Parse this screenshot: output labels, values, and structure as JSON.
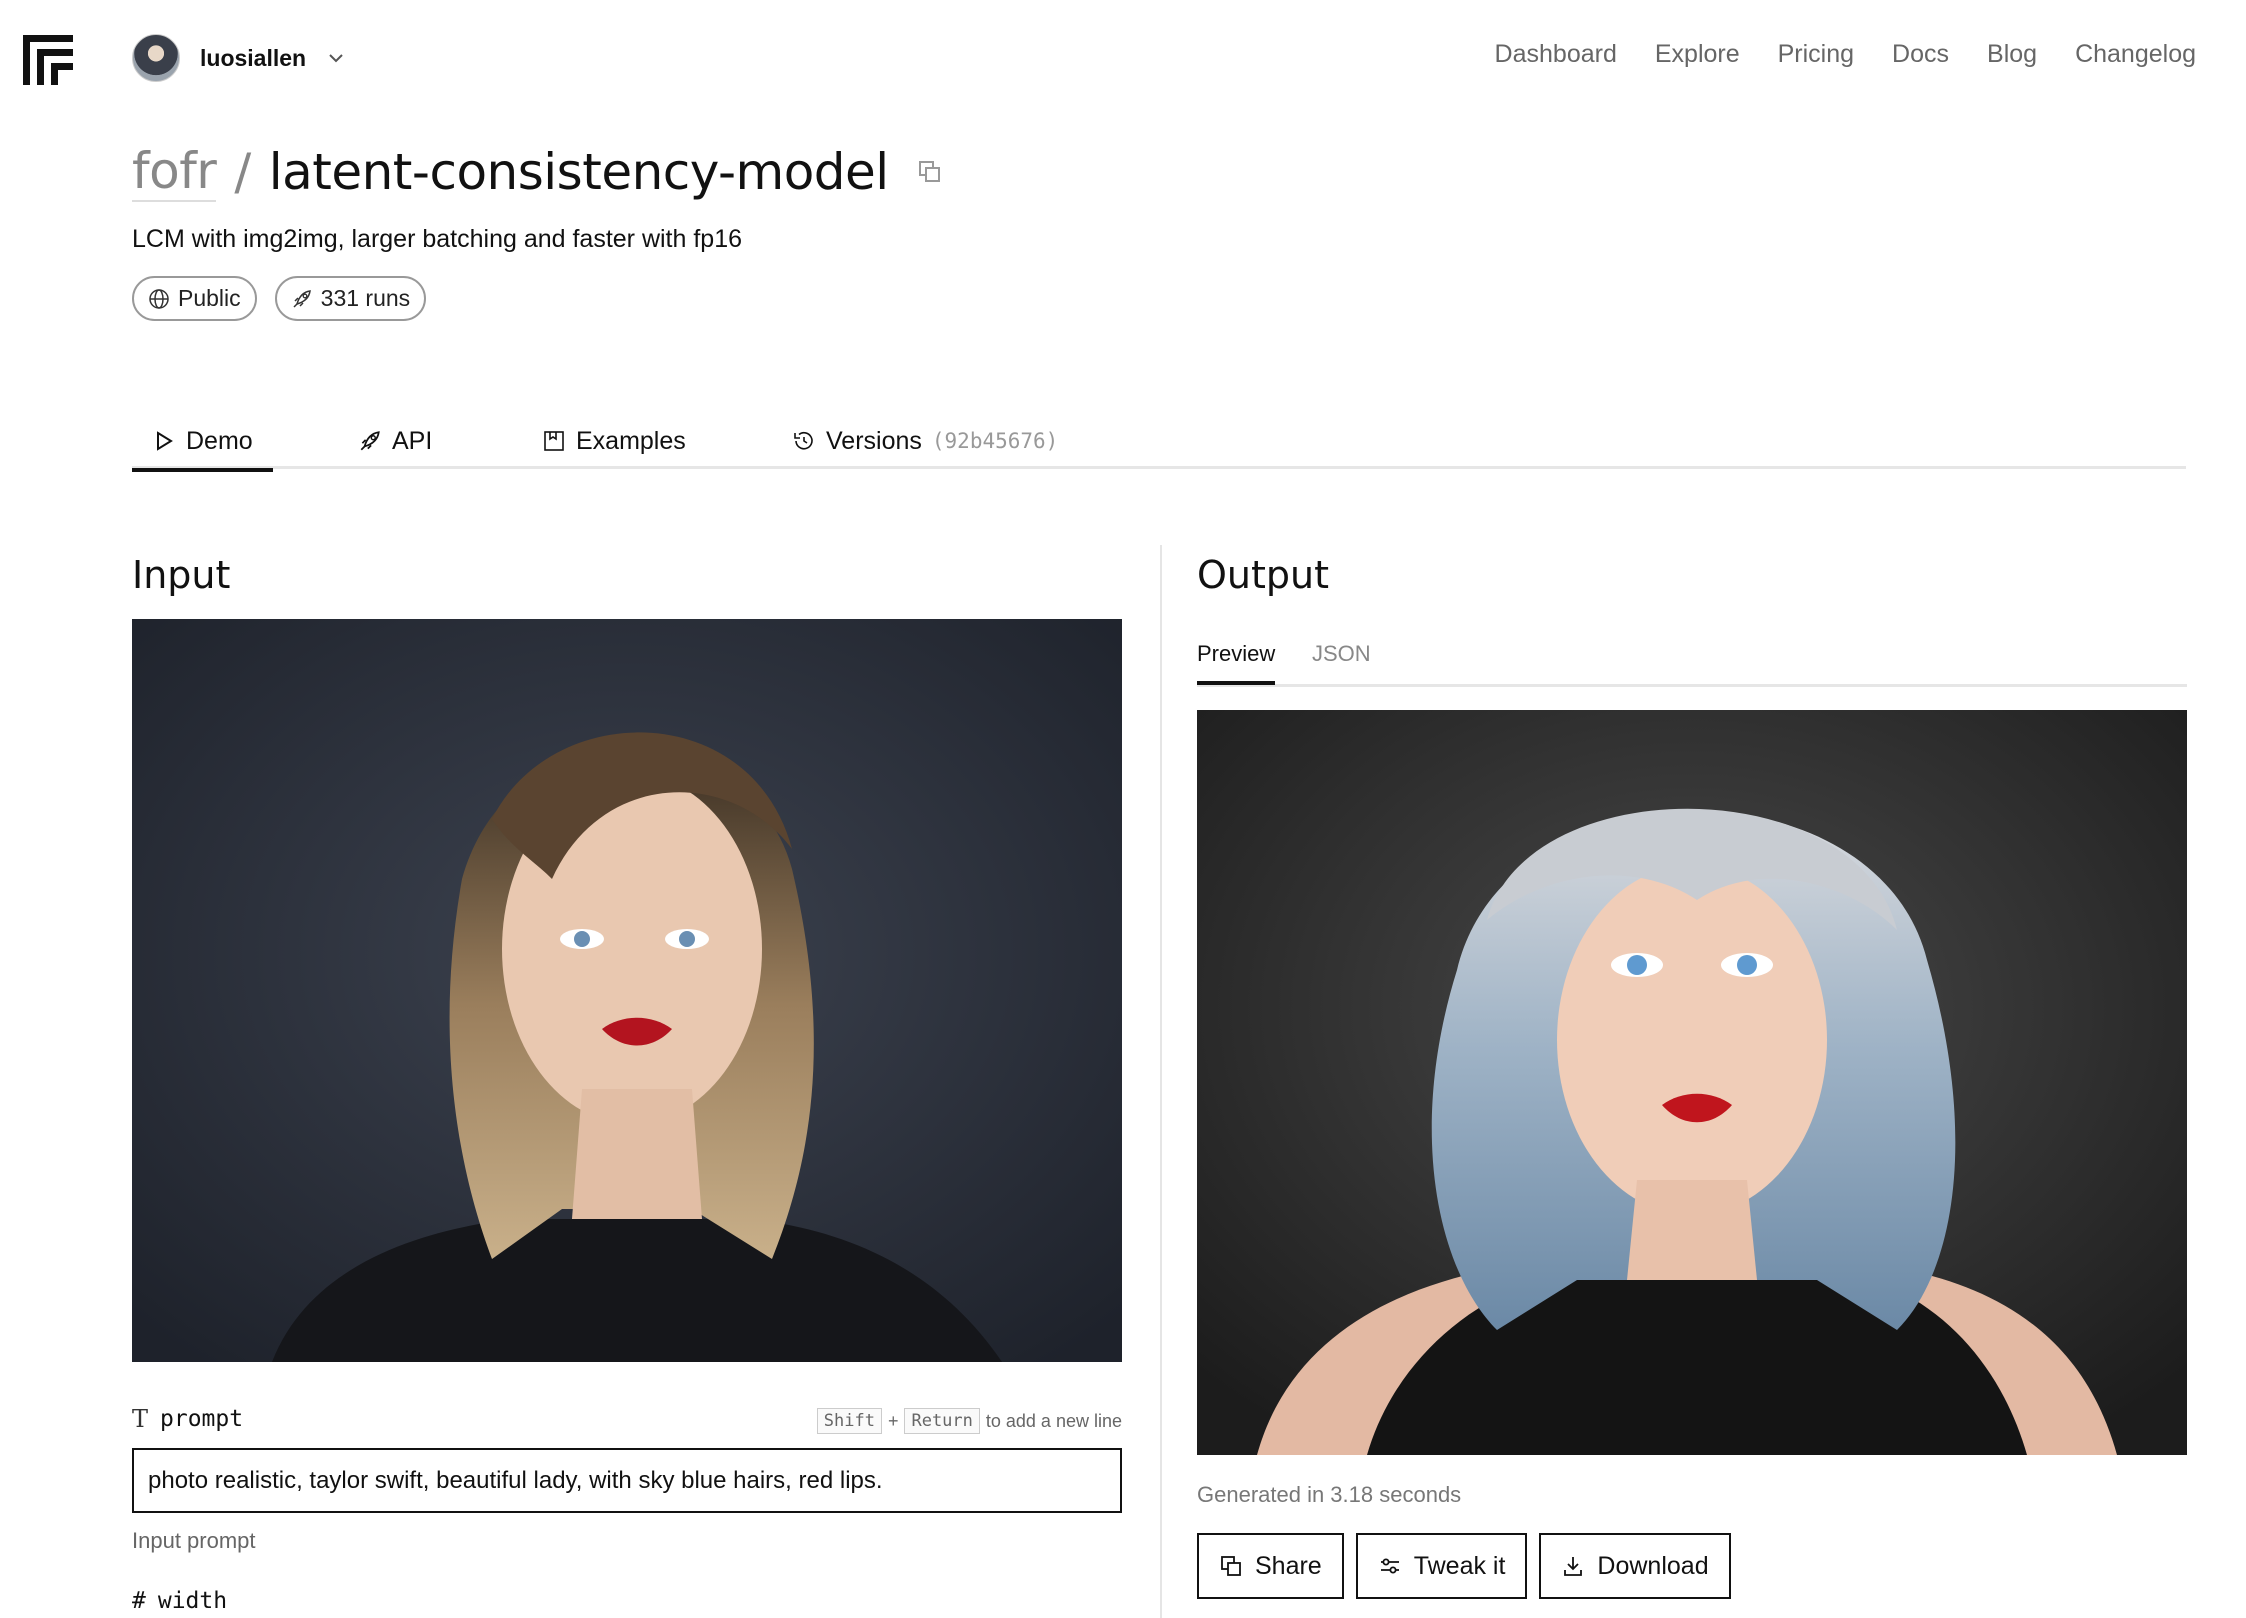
{
  "nav": {
    "username": "luosiallen",
    "links": [
      "Dashboard",
      "Explore",
      "Pricing",
      "Docs",
      "Blog",
      "Changelog"
    ]
  },
  "model": {
    "owner": "fofr",
    "separator": "/",
    "name": "latent-consistency-model",
    "description": "LCM with img2img, larger batching and faster with fp16",
    "visibility": "Public",
    "runs": "331 runs"
  },
  "tabs": {
    "demo": "Demo",
    "api": "API",
    "examples": "Examples",
    "versions": "Versions",
    "version_hash": "(92b45676)"
  },
  "input": {
    "heading": "Input",
    "prompt_label": "prompt",
    "prompt_type_glyph": "T",
    "hint_key1": "Shift",
    "hint_plus": "+",
    "hint_key2": "Return",
    "hint_text": "to add a new line",
    "prompt_value": "photo realistic, taylor swift, beautiful lady, with sky blue hairs, red lips.",
    "prompt_help": "Input prompt",
    "width_type_glyph": "#",
    "width_label": "width"
  },
  "output": {
    "heading": "Output",
    "tab_preview": "Preview",
    "tab_json": "JSON",
    "generated": "Generated in 3.18 seconds",
    "share": "Share",
    "tweak": "Tweak it",
    "download": "Download"
  }
}
